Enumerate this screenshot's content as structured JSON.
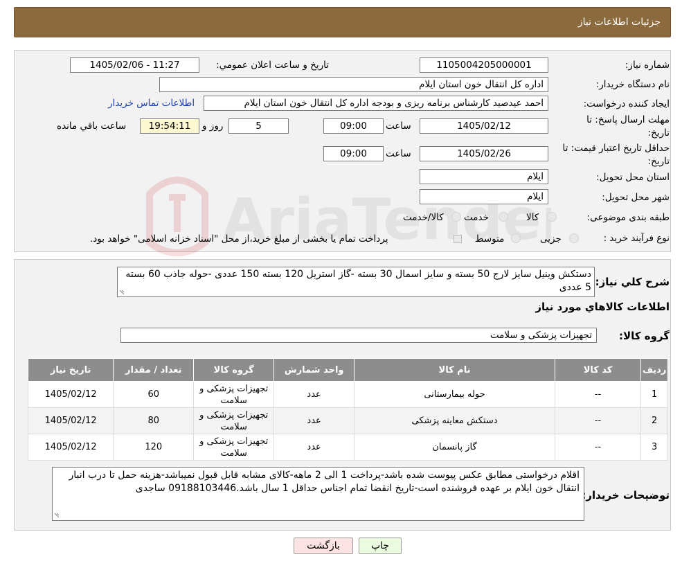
{
  "header": {
    "title": "جزئیات اطلاعات نیاز"
  },
  "need_info": {
    "need_number_label": "شماره نیاز:",
    "need_number": "1105004205000001",
    "announce_label": "تاريخ و ساعت اعلان عمومي:",
    "announce_value": "1405/02/06 - 11:27",
    "buyer_label": "نام دستگاه خریدار:",
    "buyer_value": "اداره کل انتقال خون استان ایلام",
    "creator_label": "ایجاد کننده درخواست:",
    "creator_value": "احمد عیدصید کارشناس برنامه ریزی و بودجه اداره کل انتقال خون استان ایلام",
    "contact_link": "اطلاعات تماس خریدار",
    "deadline_label": "مهلت ارسال پاسخ: تا تاریخ:",
    "deadline_date": "1405/02/12",
    "time_label": "ساعت",
    "deadline_time": "09:00",
    "days_value": "5",
    "days_label": "روز و",
    "remaining_time": "19:54:11",
    "remaining_label": "ساعت باقي مانده",
    "validity_label": "حداقل تاریخ اعتبار قیمت: تا تاریخ:",
    "validity_date": "1405/02/26",
    "validity_time": "09:00",
    "province_label": "استان محل تحویل:",
    "province_value": "ایلام",
    "city_label": "شهر محل تحویل:",
    "city_value": "ایلام",
    "category_label": "طبقه بندی موضوعی:",
    "category_options": [
      "کالا",
      "خدمت",
      "کالا/خدمت"
    ],
    "process_label": "نوع فرآیند خرید :",
    "process_options": [
      "جزیی",
      "متوسط"
    ],
    "process_note": "پرداخت تمام یا بخشی از مبلغ خرید،از محل \"اسناد خزانه اسلامی\" خواهد بود."
  },
  "description": {
    "label": "شرح کلي نياز:",
    "text": "دستکش وینیل سایز لارج 50 بسته و سایز اسمال 30 بسته -گاز استریل 120 بسته 150 عددی -حوله جاذب 60 بسته 5 عددی"
  },
  "items_section": {
    "title": "اطلاعات کالاهاي مورد نياز",
    "group_label": "گروه کالا:",
    "group_value": "تجهیزات پزشکی و سلامت",
    "columns": [
      "رديف",
      "کد کالا",
      "نام کالا",
      "واحد شمارش",
      "گروه کالا",
      "تعداد / مقدار",
      "تاريخ نياز"
    ],
    "rows": [
      {
        "row": "1",
        "code": "--",
        "name": "حوله بیمارستانی",
        "unit": "عدد",
        "group": "تجهیزات پزشکی و سلامت",
        "qty": "60",
        "date": "1405/02/12"
      },
      {
        "row": "2",
        "code": "--",
        "name": "دستکش معاینه پزشکی",
        "unit": "عدد",
        "group": "تجهیزات پزشکی و سلامت",
        "qty": "80",
        "date": "1405/02/12"
      },
      {
        "row": "3",
        "code": "--",
        "name": "گاز پانسمان",
        "unit": "عدد",
        "group": "تجهیزات پزشکی و سلامت",
        "qty": "120",
        "date": "1405/02/12"
      }
    ]
  },
  "buyer_notes": {
    "label": "توضیحات خریدار:",
    "text": "اقلام درخواستی مطابق عکس پیوست شده باشد-پرداخت 1 الی 2 ماهه-کالای مشابه قابل قبول نمیباشد-هزینه حمل تا درب انبار انتقال خون ایلام بر عهده فروشنده است-تاریخ انقضا تمام اجناس حداقل 1 سال باشد.09188103446 ساجدی"
  },
  "buttons": {
    "print": "چاپ",
    "back": "بازگشت"
  },
  "watermark": {
    "text": "AriaTender.neT"
  },
  "colors": {
    "header": "#8b6a3e",
    "table_header": "#8d8d8d",
    "link": "#1a3fb0",
    "print_bg": "#eafbe0",
    "back_bg": "#fde3e3"
  }
}
